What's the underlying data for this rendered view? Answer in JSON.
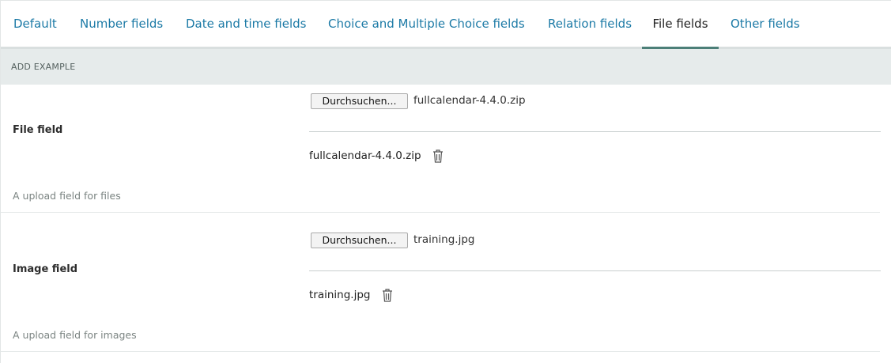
{
  "tabs": [
    {
      "label": "Default"
    },
    {
      "label": "Number fields"
    },
    {
      "label": "Date and time fields"
    },
    {
      "label": "Choice and Multiple Choice fields"
    },
    {
      "label": "Relation fields"
    },
    {
      "label": "File fields",
      "active": true
    },
    {
      "label": "Other fields"
    }
  ],
  "section": {
    "title": "ADD EXAMPLE"
  },
  "fields": [
    {
      "label": "File field",
      "help": "A upload field for files",
      "browse_label": "Durchsuchen...",
      "chosen_file": "fullcalendar-4.4.0.zip",
      "current_file": "fullcalendar-4.4.0.zip"
    },
    {
      "label": "Image field",
      "help": "A upload field for images",
      "browse_label": "Durchsuchen...",
      "chosen_file": "training.jpg",
      "current_file": "training.jpg"
    }
  ],
  "colors": {
    "link": "#1c7aa6",
    "active_underline": "#4c7f78",
    "header_bg": "#e6ebeb"
  },
  "icons": {
    "delete": "trash-icon"
  }
}
